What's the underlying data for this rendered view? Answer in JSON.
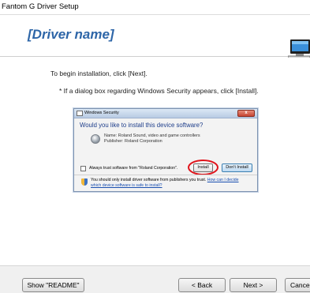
{
  "window": {
    "title": "Fantom G Driver Setup"
  },
  "header": {
    "title": "[Driver name]",
    "icon": "computer-monitor-icon"
  },
  "body": {
    "line1": "To begin installation, click [Next].",
    "line2": "* If a dialog box regarding Windows Security appears, click [Install]."
  },
  "security_dialog": {
    "title": "Windows Security",
    "close_label": "x",
    "question": "Would you like to install this device software?",
    "device_name": "Name: Roland Sound, video and game controllers",
    "publisher": "Publisher: Roland Corporation",
    "always_trust": "Always trust software from \"Roland Corporation\".",
    "install_label": "Install",
    "dont_install_label": "Don't Install",
    "footer_text": "You should only install driver software from publishers you trust.",
    "footer_link1": "How can I decide",
    "footer_link2": "which device software is safe to install?",
    "highlight_color": "#e0141b"
  },
  "buttons": {
    "readme": "Show \"README\"",
    "back": "< Back",
    "next": "Next >",
    "cancel": "Cancel"
  }
}
